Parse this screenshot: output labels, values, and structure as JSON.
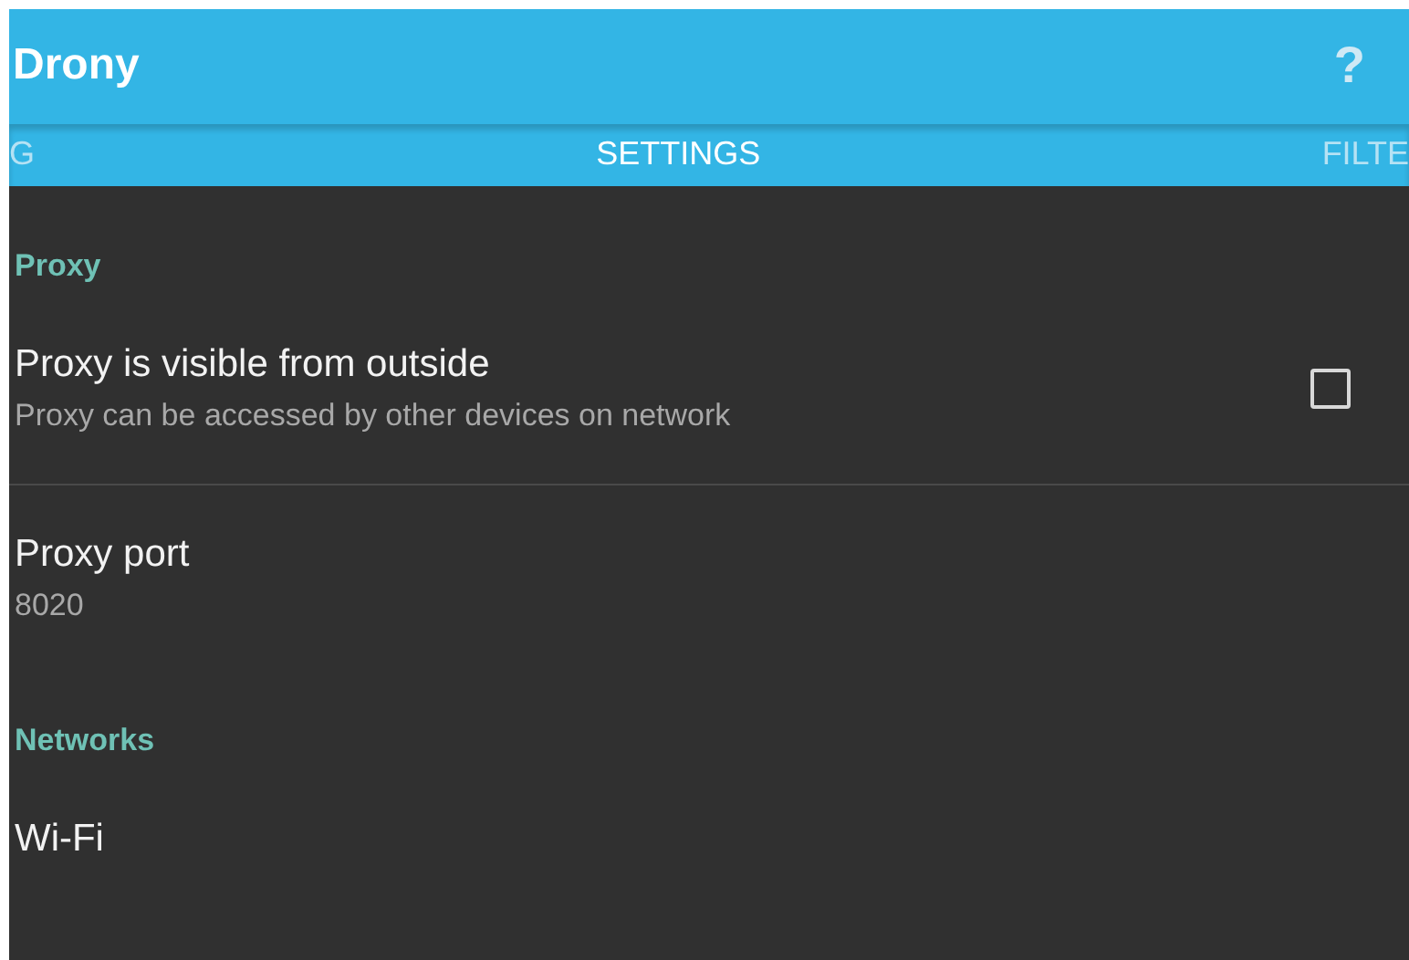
{
  "app_bar": {
    "title": "Drony",
    "help_icon": "?"
  },
  "tabs": [
    {
      "label": "G",
      "selected": false
    },
    {
      "label": "SETTINGS",
      "selected": true
    },
    {
      "label": "FILTE",
      "selected": false
    }
  ],
  "settings": [
    {
      "kind": "header",
      "title": "Proxy"
    },
    {
      "kind": "checkbox",
      "title": "Proxy is visible from outside",
      "summary": "Proxy can be accessed by other devices on network",
      "checked": false,
      "divider": true
    },
    {
      "kind": "text",
      "title": "Proxy port",
      "summary": "8020"
    },
    {
      "kind": "header",
      "title": "Networks"
    },
    {
      "kind": "text",
      "title": "Wi-Fi"
    }
  ]
}
